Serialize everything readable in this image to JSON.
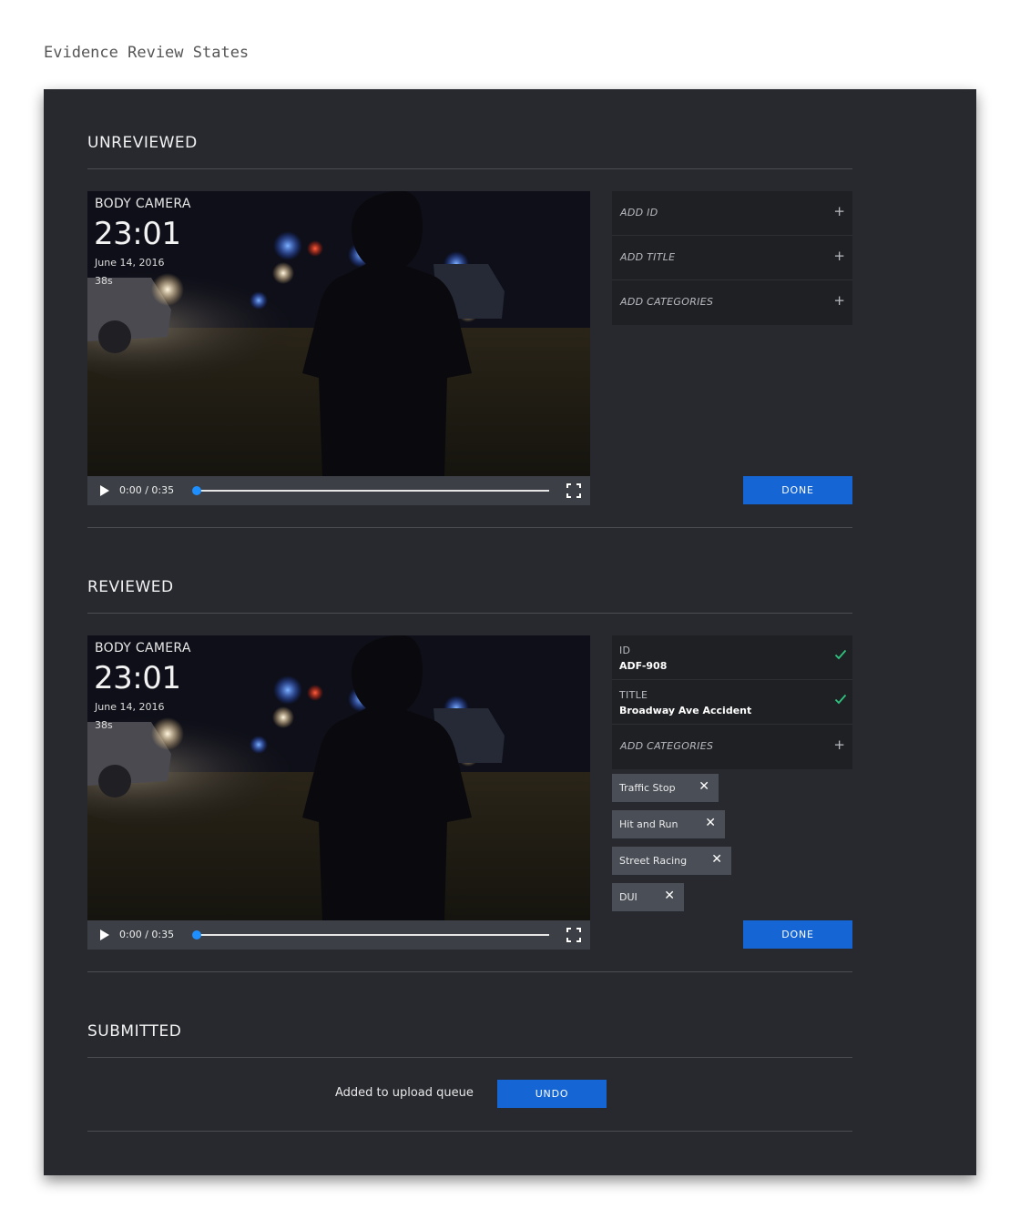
{
  "page_title": "Evidence Review States",
  "video_common": {
    "source": "BODY CAMERA",
    "time": "23:01",
    "date": "June 14, 2016",
    "length": "38s",
    "player_time": "0:00 / 0:35",
    "progress": 0.0
  },
  "unreviewed": {
    "heading": "UNREVIEWED",
    "fields": [
      {
        "label": "ADD ID",
        "icon": "plus-icon"
      },
      {
        "label": "ADD TITLE",
        "icon": "plus-icon"
      },
      {
        "label": "ADD CATEGORIES",
        "icon": "plus-icon"
      }
    ],
    "done_label": "DONE"
  },
  "reviewed": {
    "heading": "REVIEWED",
    "id_caption": "ID",
    "id_value": "ADF-908",
    "title_caption": "TITLE",
    "title_value": "Broadway Ave Accident",
    "categories_label": "ADD CATEGORIES",
    "tags": [
      "Traffic Stop",
      "Hit and Run",
      "Street Racing",
      "DUI"
    ],
    "done_label": "DONE"
  },
  "submitted": {
    "heading": "SUBMITTED",
    "message": "Added to upload queue",
    "undo_label": "UNDO"
  },
  "colors": {
    "panel_bg": "#27292e",
    "field_bg": "#1f2024",
    "accent_blue": "#1565d4",
    "check_green": "#2ec27e",
    "tag_bg": "#4a4e57"
  }
}
